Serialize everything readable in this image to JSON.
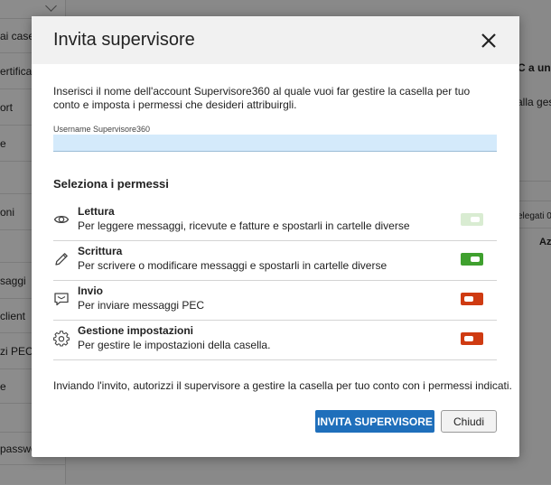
{
  "background": {
    "sidebar_items": [
      {
        "label": "ai casella"
      },
      {
        "label": "ertificati"
      },
      {
        "label": "ort"
      },
      {
        "label": "e"
      },
      {
        "label": ""
      },
      {
        "label": "oni"
      },
      {
        "label": ""
      },
      {
        "label": "saggi"
      },
      {
        "label": "client"
      },
      {
        "label": "zi PEC"
      },
      {
        "label": "e"
      },
      {
        "label": ""
      },
      {
        "label": "passwo"
      }
    ],
    "main_texts": {
      "heading_fragment": "C a un",
      "sub_fragment": "alla ges",
      "delegati": "elegati 0",
      "col_fragment": "Az"
    }
  },
  "modal": {
    "title": "Invita supervisore",
    "close_icon": "close-icon",
    "intro": "Inserisci il nome dell'account Supervisore360 al quale vuoi far gestire la casella per tuo conto e imposta i permessi che desideri attribuirgli.",
    "username_label": "Username Supervisore360",
    "username_value": "",
    "username_placeholder": "",
    "permissions_title": "Seleziona i permessi",
    "permissions": [
      {
        "icon": "eye-icon",
        "name": "Lettura",
        "description": "Per leggere messaggi, ricevute e fatture e spostarli in cartelle diverse",
        "state": "on-disabled",
        "color": "#d9ecd2"
      },
      {
        "icon": "pencil-icon",
        "name": "Scrittura",
        "description": "Per scrivere o modificare messaggi e spostarli in cartelle diverse",
        "state": "on",
        "color": "#3fa02e"
      },
      {
        "icon": "message-icon",
        "name": "Invio",
        "description": "Per inviare messaggi PEC",
        "state": "off",
        "color": "#cf3b12"
      },
      {
        "icon": "gear-icon",
        "name": "Gestione impostazioni",
        "description": "Per gestire le impostazioni della casella.",
        "state": "off",
        "color": "#cf3b12"
      }
    ],
    "footer_note": "Inviando l'invito, autorizzi il supervisore a gestire la casella per tuo conto con i permessi indicati.",
    "primary_button": "INVITA SUPERVISORE",
    "secondary_button": "Chiudi",
    "colors": {
      "accent": "#1f6fbb",
      "input_bg": "#d4eafb",
      "toggle_on": "#3fa02e",
      "toggle_on_disabled": "#d9ecd2",
      "toggle_off": "#cf3b12"
    }
  }
}
